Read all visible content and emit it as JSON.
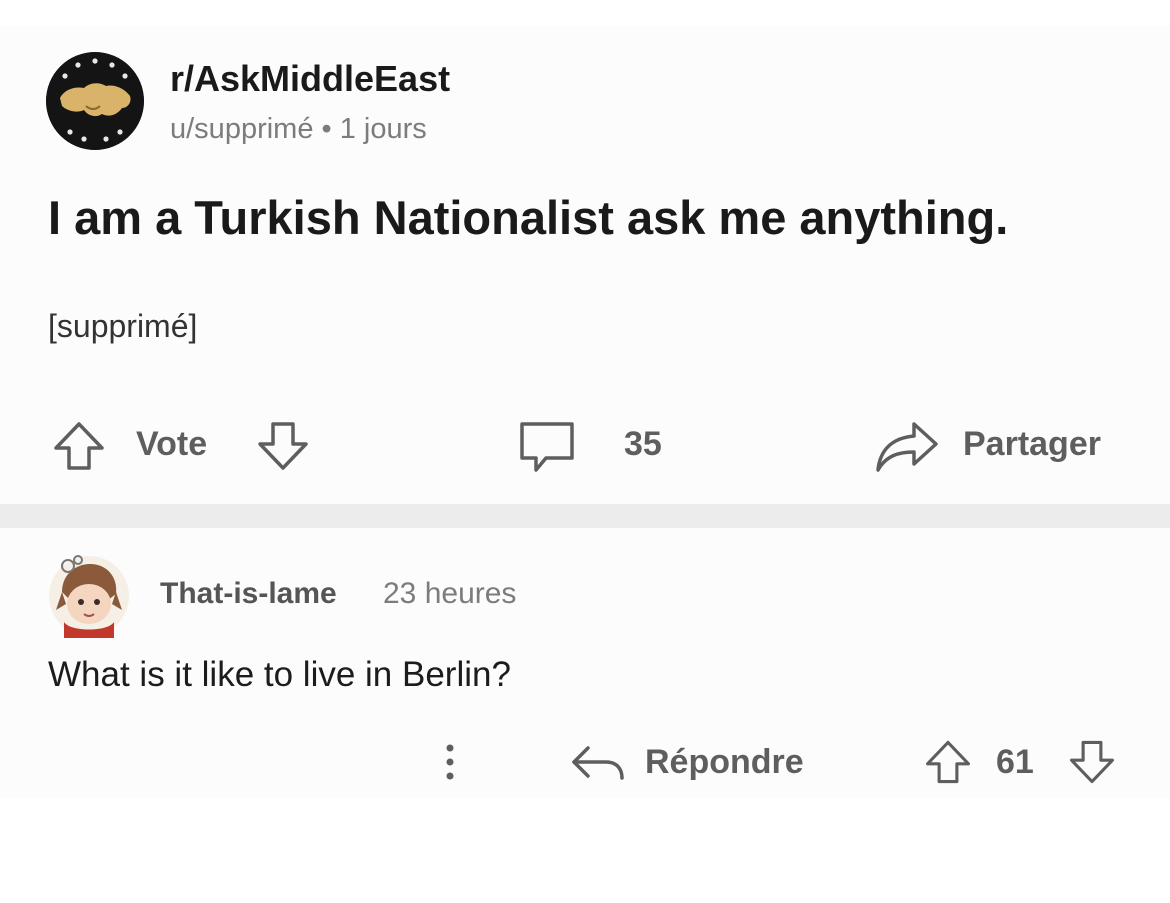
{
  "post": {
    "subreddit": "r/AskMiddleEast",
    "meta": "u/supprimé • 1 jours",
    "title": "I am a Turkish Nationalist ask me anything.",
    "body": "[supprimé]",
    "vote_label": "Vote",
    "comment_count": "35",
    "share_label": "Partager"
  },
  "comment": {
    "author": "That-is-lame",
    "time": "23 heures",
    "text": "What is it like to live in Berlin?",
    "reply_label": "Répondre",
    "score": "61"
  },
  "icons": {
    "subreddit_avatar": "subreddit-map-icon",
    "upvote": "arrow-up-icon",
    "downvote": "arrow-down-icon",
    "comments": "comment-bubble-icon",
    "share": "share-arrow-icon",
    "more": "more-vertical-icon",
    "reply": "reply-arrow-icon"
  },
  "colors": {
    "card_bg": "#fcfcfc",
    "separator": "#ececec",
    "text_primary": "#1a1a1a",
    "text_muted": "#7c7c7c",
    "action_gray": "#5e5e5e"
  }
}
